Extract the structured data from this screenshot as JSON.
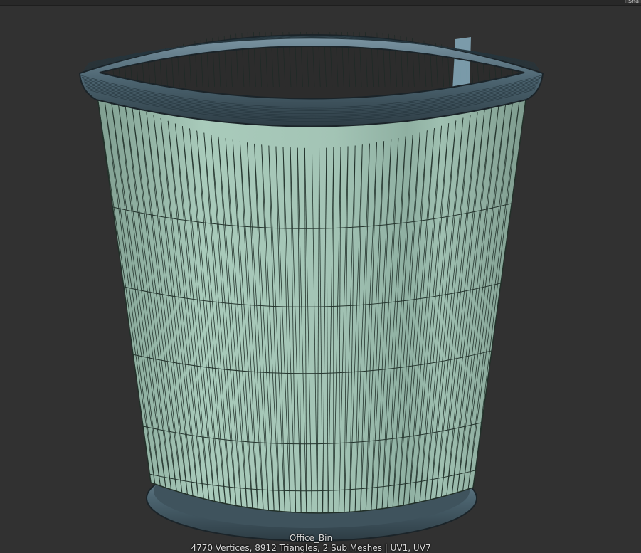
{
  "header": {
    "tab_label": "Sha"
  },
  "preview": {
    "object_name": "Office_Bin",
    "stats_text": "4770 Vertices, 8912 Triangles, 2 Sub Meshes | UV1, UV7",
    "colors": {
      "background": "#313131",
      "body": "#9fc1b1",
      "rim": "#4e6673",
      "wire": "#1f2f2a"
    }
  }
}
